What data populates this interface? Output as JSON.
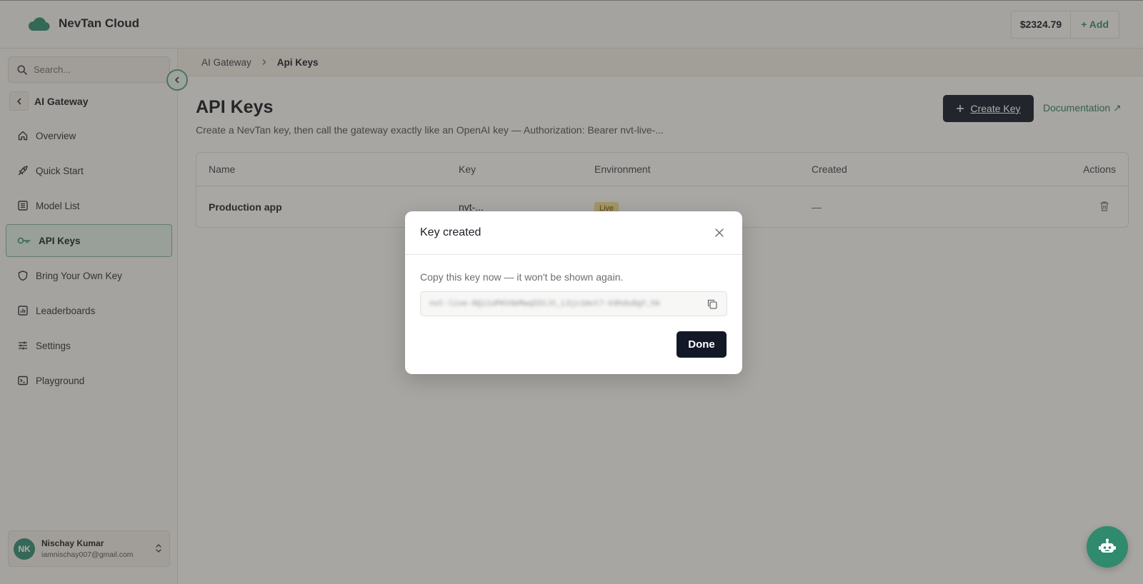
{
  "header": {
    "brand_name": "NevTan Cloud",
    "balance": "$2324.79",
    "add_label": "+ Add"
  },
  "sidebar": {
    "search_placeholder": "Search...",
    "section_title": "AI Gateway",
    "items": [
      {
        "label": "Overview",
        "icon": "home-icon"
      },
      {
        "label": "Quick Start",
        "icon": "rocket-icon"
      },
      {
        "label": "Model List",
        "icon": "list-icon"
      },
      {
        "label": "API Keys",
        "icon": "key-icon",
        "active": true
      },
      {
        "label": "Bring Your Own Key",
        "icon": "shield-icon"
      },
      {
        "label": "Leaderboards",
        "icon": "chart-icon"
      },
      {
        "label": "Settings",
        "icon": "sliders-icon"
      },
      {
        "label": "Playground",
        "icon": "terminal-icon"
      }
    ],
    "user": {
      "initials": "NK",
      "name": "Nischay Kumar",
      "email": "iamnischay007@gmail.com"
    }
  },
  "breadcrumb": {
    "parent": "AI Gateway",
    "current": "Api Keys"
  },
  "page": {
    "title": "API Keys",
    "subtitle": "Create a NevTan key, then call the gateway exactly like an OpenAI key — Authorization: Bearer nvt-live-...",
    "create_label": "Create Key",
    "docs_label": "Documentation ↗"
  },
  "table": {
    "headers": [
      "Name",
      "Key",
      "Environment",
      "Created",
      "Actions"
    ],
    "rows": [
      {
        "name": "Production app",
        "key": "nvt-...",
        "environment": "Live",
        "created": "—"
      }
    ]
  },
  "modal": {
    "title": "Key created",
    "message": "Copy this key now — it won't be shown again.",
    "key_value": "nvt-live-9Qi1oPKVdeMwq55tJt_L3jc1mvt7-k9hdu8gY_hk",
    "done_label": "Done"
  },
  "colors": {
    "accent": "#2f8a6e",
    "primary_button": "#121826",
    "active_nav_bg": "#dcebe1"
  }
}
